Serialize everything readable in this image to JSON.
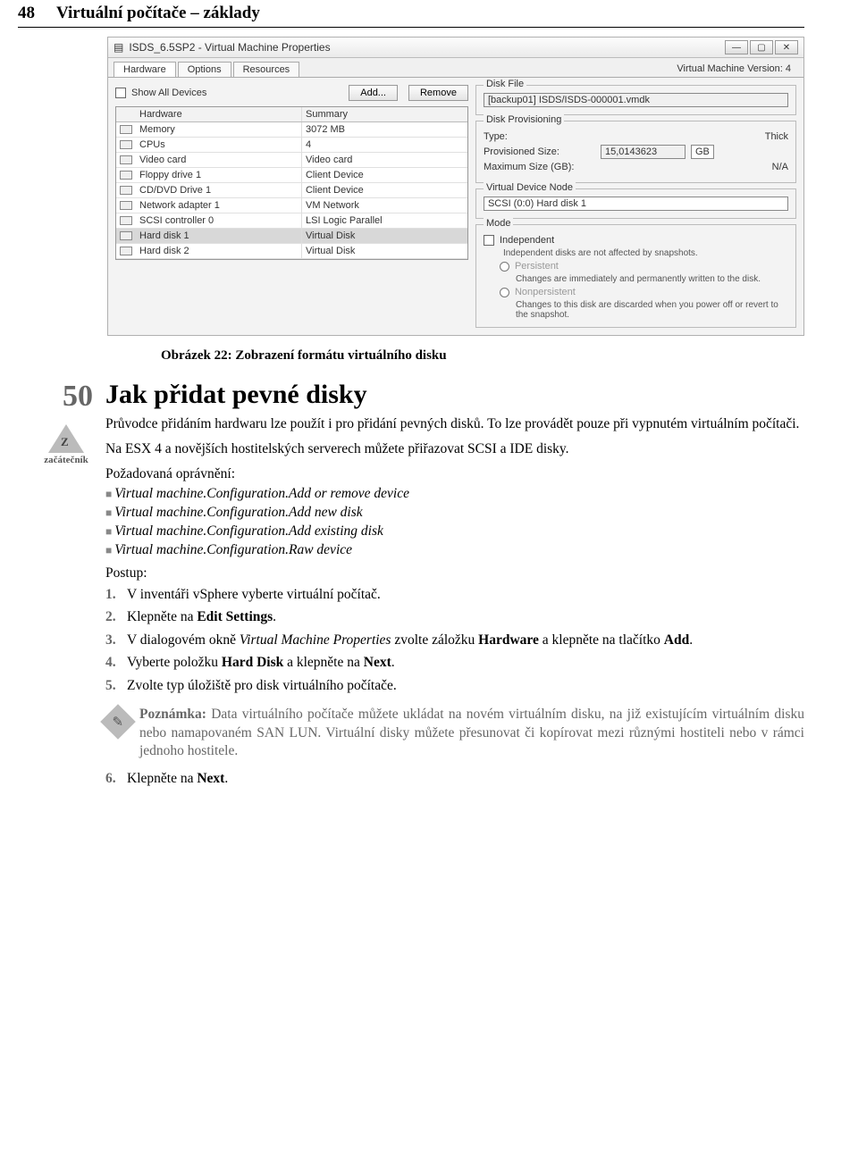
{
  "page": {
    "number": "48",
    "header_title": "Virtuální počítače – základy"
  },
  "dialog": {
    "title": "ISDS_6.5SP2 - Virtual Machine Properties",
    "win_min": "—",
    "win_max": "▢",
    "win_close": "✕",
    "tabs": {
      "hardware": "Hardware",
      "options": "Options",
      "resources": "Resources"
    },
    "vm_version": "Virtual Machine Version: 4",
    "show_all": "Show All Devices",
    "btn_add": "Add...",
    "btn_remove": "Remove",
    "col_hardware": "Hardware",
    "col_summary": "Summary",
    "rows": [
      {
        "name": "Memory",
        "summary": "3072 MB"
      },
      {
        "name": "CPUs",
        "summary": "4"
      },
      {
        "name": "Video card",
        "summary": "Video card"
      },
      {
        "name": "Floppy drive 1",
        "summary": "Client Device"
      },
      {
        "name": "CD/DVD Drive 1",
        "summary": "Client Device"
      },
      {
        "name": "Network adapter 1",
        "summary": "VM Network"
      },
      {
        "name": "SCSI controller 0",
        "summary": "LSI Logic Parallel"
      },
      {
        "name": "Hard disk 1",
        "summary": "Virtual Disk"
      },
      {
        "name": "Hard disk 2",
        "summary": "Virtual Disk"
      }
    ],
    "group_diskfile": "Disk File",
    "diskfile_value": "[backup01] ISDS/ISDS-000001.vmdk",
    "group_prov": "Disk Provisioning",
    "prov_type_label": "Type:",
    "prov_type_value": "Thick",
    "prov_size_label": "Provisioned Size:",
    "prov_size_value": "15,0143623",
    "prov_size_unit": "GB",
    "prov_max_label": "Maximum Size (GB):",
    "prov_max_value": "N/A",
    "group_node": "Virtual Device Node",
    "node_value": "SCSI (0:0) Hard disk 1",
    "group_mode": "Mode",
    "mode_independent": "Independent",
    "mode_ind_note": "Independent disks are not affected by snapshots.",
    "mode_persistent": "Persistent",
    "mode_persistent_note": "Changes are immediately and permanently written to the disk.",
    "mode_nonpersistent": "Nonpersistent",
    "mode_nonpersistent_note": "Changes to this disk are discarded when you power off or revert to the snapshot."
  },
  "caption": "Obrázek 22: Zobrazení formátu virtuálního disku",
  "tip": {
    "number": "50",
    "title": "Jak přidat pevné disky",
    "level": "začátečník"
  },
  "para1": "Průvodce přidáním hardwaru lze použít i pro přidání pevných disků. To lze provádět pouze při vypnutém virtuálním počítači.",
  "para2": "Na ESX 4 a novějších hostitelských serverech můžete přiřazovat SCSI a IDE disky.",
  "perm_label": "Požadovaná oprávnění:",
  "perms": [
    "Virtual machine.Configuration.Add or remove device",
    "Virtual machine.Configuration.Add new disk",
    "Virtual machine.Configuration.Add existing disk",
    "Virtual machine.Configuration.Raw device"
  ],
  "postup": "Postup:",
  "steps": {
    "s1": "V inventáři vSphere vyberte virtuální počítač.",
    "s2a": "Klepněte na ",
    "s2b": "Edit Settings",
    "s2c": ".",
    "s3a": "V dialogovém okně ",
    "s3b": "Virtual Machine Properties",
    "s3c": " zvolte záložku ",
    "s3d": "Hardware",
    "s3e": " a klepněte na tlačítko ",
    "s3f": "Add",
    "s3g": ".",
    "s4a": "Vyberte položku ",
    "s4b": "Hard Disk",
    "s4c": " a klepněte na ",
    "s4d": "Next",
    "s4e": ".",
    "s5": "Zvolte typ úložiště pro disk virtuálního počítače."
  },
  "note": {
    "label": "Poznámka:",
    "text": " Data virtuálního počítače můžete ukládat na novém virtuálním disku, na již existujícím virtuálním disku nebo namapovaném SAN LUN. Virtuální disky můžete přesunovat či kopírovat mezi různými hostiteli nebo v rámci jednoho hostitele."
  },
  "step6a": "Klepněte na ",
  "step6b": "Next",
  "step6c": "."
}
